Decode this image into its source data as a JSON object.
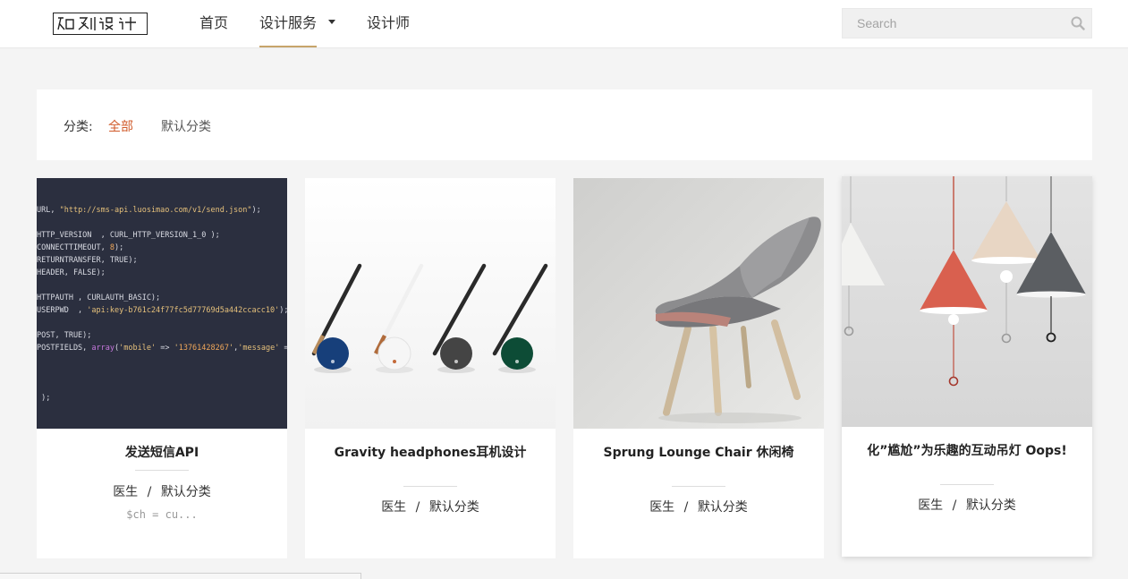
{
  "header": {
    "logo_text": "如刻设计",
    "nav": [
      {
        "label": "首页"
      },
      {
        "label": "设计服务"
      },
      {
        "label": "设计师"
      }
    ],
    "search": {
      "placeholder": "Search",
      "icon": "search-icon"
    }
  },
  "filter": {
    "label": "分类:",
    "options": [
      {
        "label": "全部",
        "active": true
      },
      {
        "label": "默认分类",
        "active": false
      }
    ]
  },
  "colors": {
    "accent": "#c7a46a",
    "active_filter": "#d05a2a",
    "page_bg": "#f4f4f4",
    "code_bg": "#2b2f3f"
  },
  "code_snippet": {
    "lines": [
      "URL, \"http://sms-api.luosimao.com/v1/send.json\");",
      "",
      "HTTP_VERSION  , CURL_HTTP_VERSION_1_0 );",
      "CONNECTTIMEOUT, 8);",
      "RETURNTRANSFER, TRUE);",
      "HEADER, FALSE);",
      "",
      "HTTPAUTH , CURLAUTH_BASIC);",
      "USERPWD  , 'api:key-b761c24f77fc5d77769d5a442ccacc10');",
      "",
      "POST, TRUE);",
      "POSTFIELDS, array('mobile' => '13761428267','message' =>",
      "",
      "",
      "",
      " );"
    ]
  },
  "cards": [
    {
      "title": "发送短信API",
      "author": "医生",
      "separator": "/",
      "category": "默认分类",
      "excerpt": "$ch = cu..."
    },
    {
      "title": "Gravity headphones耳机设计",
      "author": "医生",
      "separator": "/",
      "category": "默认分类"
    },
    {
      "title": "Sprung Lounge Chair 休闲椅",
      "author": "医生",
      "separator": "/",
      "category": "默认分类"
    },
    {
      "title": "化”尴尬”为乐趣的互动吊灯 Oops!",
      "author": "医生",
      "separator": "/",
      "category": "默认分类"
    }
  ]
}
